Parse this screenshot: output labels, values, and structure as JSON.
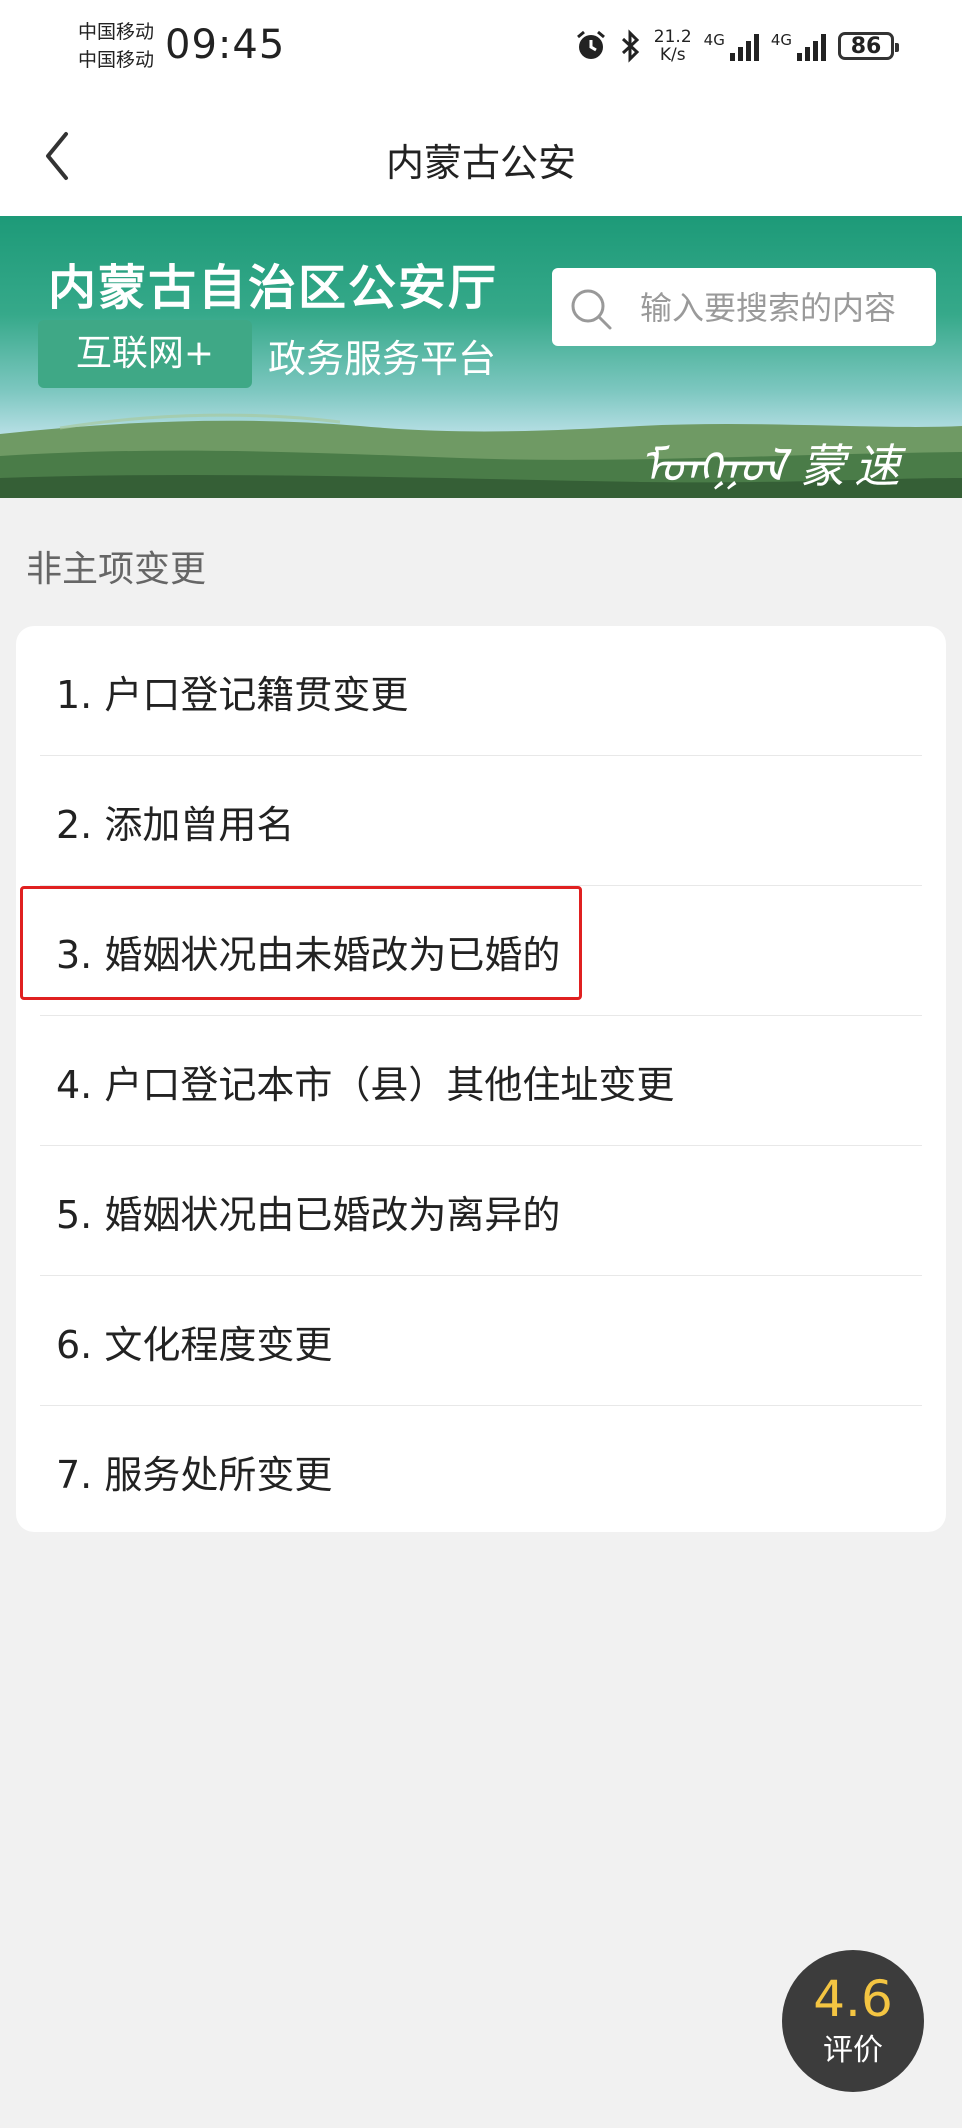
{
  "status_bar": {
    "carrier1": "中国移动",
    "carrier2": "中国移动",
    "time": "09:45",
    "speed_value": "21.2",
    "speed_unit": "K/s",
    "net1": "4G",
    "net2": "4G",
    "battery": "86"
  },
  "nav": {
    "title": "内蒙古公安",
    "back_icon": "chevron-left-icon"
  },
  "banner": {
    "title": "内蒙古自治区公安厅",
    "tag": "互联网+",
    "subtitle": "政务服务平台",
    "search_placeholder": "输入要搜索的内容",
    "slogan": "ᠮᠣᠩᠭᠣᠯ",
    "slogan_cn": "蒙速办"
  },
  "section": {
    "title": "非主项变更"
  },
  "items": [
    {
      "label": "1. 户口登记籍贯变更"
    },
    {
      "label": "2. 添加曾用名"
    },
    {
      "label": "3. 婚姻状况由未婚改为已婚的"
    },
    {
      "label": "4. 户口登记本市（县）其他住址变更"
    },
    {
      "label": "5. 婚姻状况由已婚改为离异的"
    },
    {
      "label": "6. 文化程度变更"
    },
    {
      "label": "7. 服务处所变更"
    }
  ],
  "highlight_color": "#e02020",
  "brand_color": "#1d9a78",
  "rating": {
    "score": "4.6",
    "label": "评价"
  }
}
